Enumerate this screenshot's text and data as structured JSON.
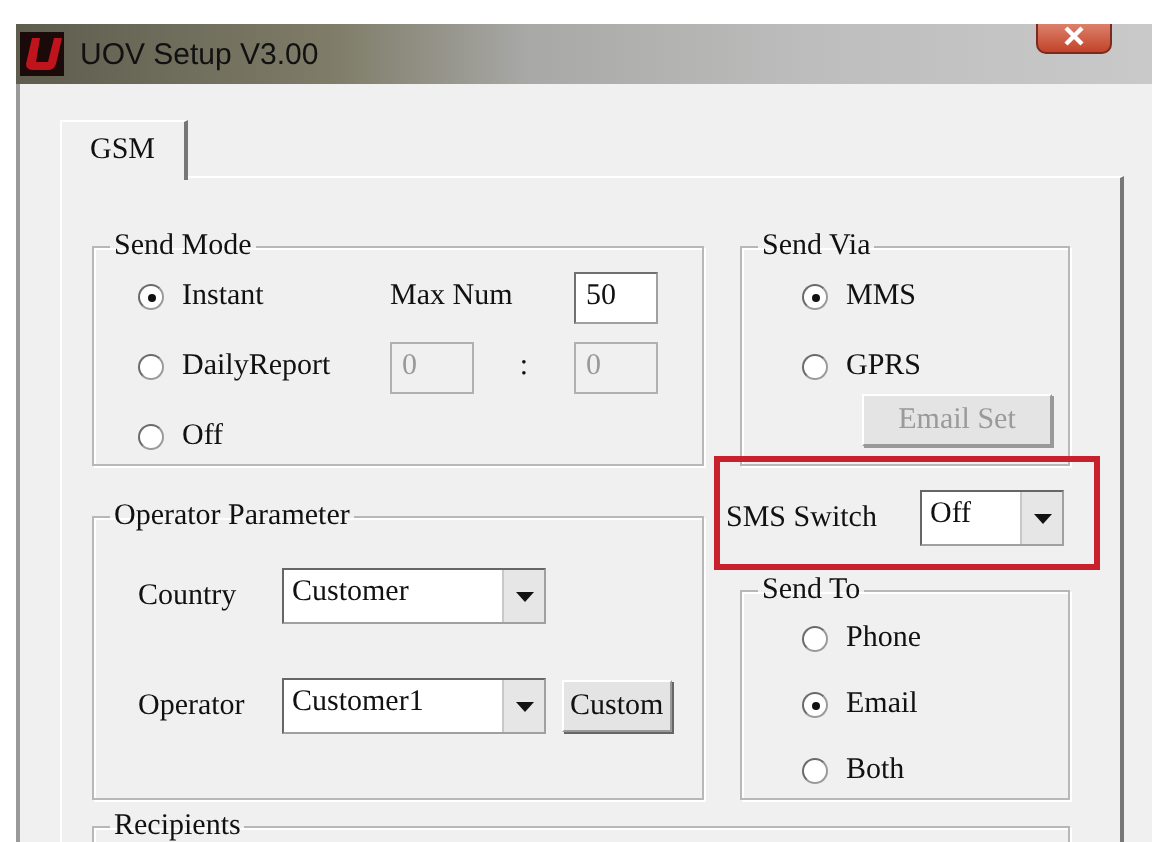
{
  "window": {
    "title": "UOV Setup V3.00"
  },
  "tabs": [
    {
      "label": "GSM",
      "selected": true
    }
  ],
  "send_mode": {
    "title": "Send Mode",
    "options": [
      {
        "label": "Instant",
        "selected": true
      },
      {
        "label": "DailyReport",
        "selected": false
      },
      {
        "label": "Off",
        "selected": false
      }
    ],
    "max_num": {
      "label": "Max Num",
      "value": "50"
    },
    "daily_time": {
      "hour": {
        "value": "0",
        "disabled": true
      },
      "separator": ":",
      "minute": {
        "value": "0",
        "disabled": true
      }
    }
  },
  "send_via": {
    "title": "Send Via",
    "options": [
      {
        "label": "MMS",
        "selected": true
      },
      {
        "label": "GPRS",
        "selected": false
      }
    ],
    "email_set": {
      "label": "Email Set",
      "disabled": true
    }
  },
  "sms_switch": {
    "label": "SMS Switch",
    "value": "Off"
  },
  "operator_parameter": {
    "title": "Operator Parameter",
    "country": {
      "label": "Country",
      "value": "Customer"
    },
    "operator": {
      "label": "Operator",
      "value": "Customer1"
    },
    "custom_button": {
      "label": "Custom"
    }
  },
  "send_to": {
    "title": "Send To",
    "options": [
      {
        "label": "Phone",
        "selected": false
      },
      {
        "label": "Email",
        "selected": true
      },
      {
        "label": "Both",
        "selected": false
      }
    ]
  },
  "recipients": {
    "title": "Recipients"
  }
}
